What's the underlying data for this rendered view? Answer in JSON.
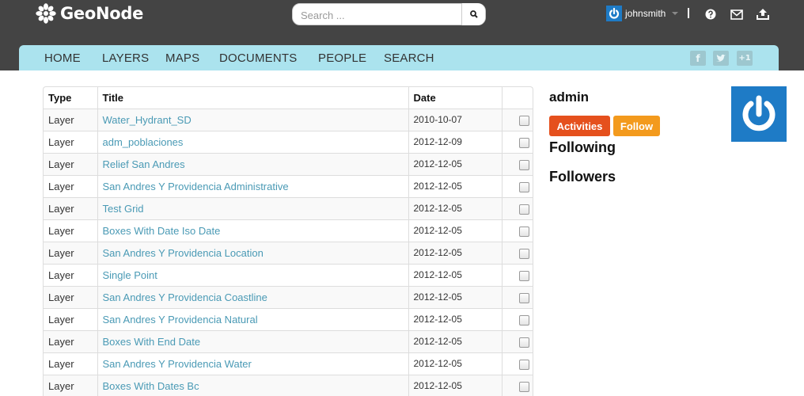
{
  "brand": {
    "name": "GeoNode"
  },
  "search": {
    "placeholder": "Search ..."
  },
  "user": {
    "name": "johnsmith"
  },
  "nav": [
    {
      "label": "HOME"
    },
    {
      "label": "LAYERS"
    },
    {
      "label": "MAPS"
    },
    {
      "label": "DOCUMENTS"
    },
    {
      "label": "PEOPLE"
    },
    {
      "label": "SEARCH"
    }
  ],
  "social": [
    "facebook-icon",
    "twitter-icon",
    "google-plus-icon"
  ],
  "table": {
    "headers": {
      "type": "Type",
      "title": "Title",
      "date": "Date"
    },
    "rows": [
      {
        "type": "Layer",
        "title": "Water_Hydrant_SD",
        "date": "2010-10-07"
      },
      {
        "type": "Layer",
        "title": "adm_poblaciones",
        "date": "2012-12-09"
      },
      {
        "type": "Layer",
        "title": "Relief San Andres",
        "date": "2012-12-05"
      },
      {
        "type": "Layer",
        "title": "San Andres Y Providencia Administrative",
        "date": "2012-12-05"
      },
      {
        "type": "Layer",
        "title": "Test Grid",
        "date": "2012-12-05"
      },
      {
        "type": "Layer",
        "title": "Boxes With Date Iso Date",
        "date": "2012-12-05"
      },
      {
        "type": "Layer",
        "title": "San Andres Y Providencia Location",
        "date": "2012-12-05"
      },
      {
        "type": "Layer",
        "title": "Single Point",
        "date": "2012-12-05"
      },
      {
        "type": "Layer",
        "title": "San Andres Y Providencia Coastline",
        "date": "2012-12-05"
      },
      {
        "type": "Layer",
        "title": "San Andres Y Providencia Natural",
        "date": "2012-12-05"
      },
      {
        "type": "Layer",
        "title": "Boxes With End Date",
        "date": "2012-12-05"
      },
      {
        "type": "Layer",
        "title": "San Andres Y Providencia Water",
        "date": "2012-12-05"
      },
      {
        "type": "Layer",
        "title": "Boxes With Dates Bc",
        "date": "2012-12-05"
      }
    ]
  },
  "profile": {
    "name": "admin",
    "activities_label": "Activities",
    "follow_label": "Follow",
    "following_heading": "Following",
    "followers_heading": "Followers"
  },
  "colors": {
    "topbar": "#444444",
    "navbar": "#abe3ee",
    "link": "#4a9ab5",
    "activities": "#e5501d",
    "follow": "#f39a1d",
    "avatar": "#1e7bc6"
  }
}
